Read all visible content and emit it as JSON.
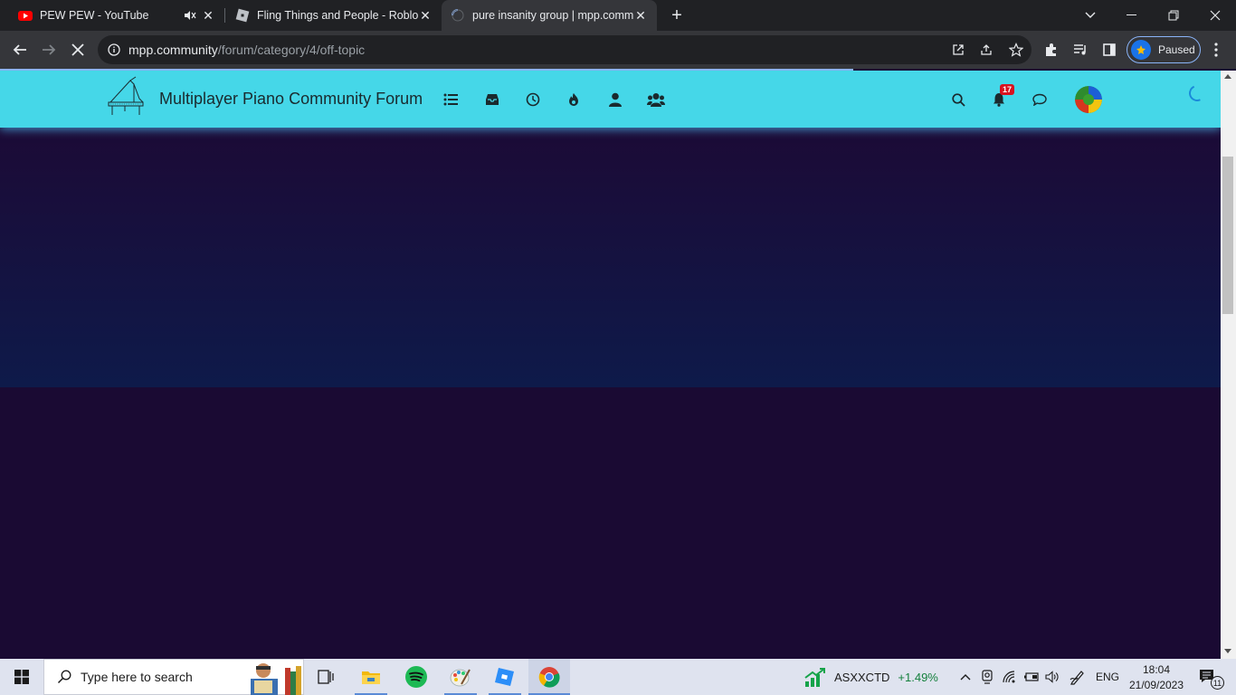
{
  "browser": {
    "tabs": [
      {
        "title": "PEW PEW - YouTube",
        "favicon": "youtube-icon",
        "audio": "speaker-muted-icon"
      },
      {
        "title": "Fling Things and People - Roblox",
        "favicon": "roblox-icon"
      },
      {
        "title": "pure insanity group | mpp.comm",
        "favicon": "loading-spinner-icon",
        "active": true
      }
    ],
    "new_tab_glyph": "+",
    "url_host": "mpp.community",
    "url_path": "/forum/category/4/off-topic",
    "profile_label": "Paused",
    "loading_progress_percent": 69
  },
  "forum": {
    "title": "Multiplayer Piano Community Forum",
    "nav_icons": [
      "categories-list-icon",
      "inbox-icon",
      "recent-clock-icon",
      "popular-fire-icon",
      "user-icon",
      "groups-icon"
    ],
    "notifications_count": "17",
    "colors": {
      "header": "#45d7e8",
      "page_bg": "#1a0a33"
    }
  },
  "taskbar": {
    "search_placeholder": "Type here to search",
    "stock_ticker": "ASXXCTD",
    "stock_change": "+1.49%",
    "language": "ENG",
    "time": "18:04",
    "date": "21/09/2023",
    "notification_count": "11"
  }
}
